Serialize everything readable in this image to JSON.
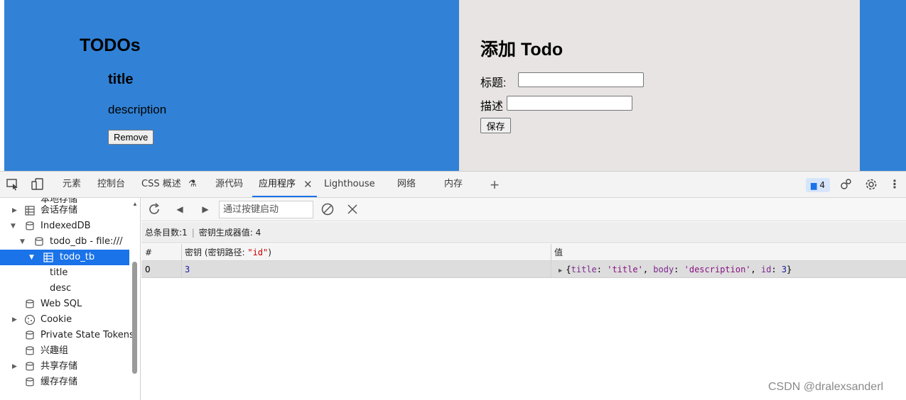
{
  "page": {
    "todos_heading": "TODOs",
    "todo_item": {
      "title": "title",
      "description": "description",
      "remove_label": "Remove"
    },
    "add_heading": "添加 Todo",
    "form": {
      "title_label": "标题:",
      "title_value": "",
      "desc_label": "描述",
      "desc_value": "",
      "save_label": "保存"
    },
    "colors": {
      "blue": "#3182d6",
      "panel_gray": "#e8e4e3"
    }
  },
  "devtools": {
    "tabs": [
      {
        "label": "元素"
      },
      {
        "label": "控制台"
      },
      {
        "label": "CSS 概述"
      },
      {
        "label": "源代码"
      },
      {
        "label": "应用程序",
        "active": true
      },
      {
        "label": "Lighthouse"
      },
      {
        "label": "网络"
      },
      {
        "label": "内存"
      }
    ],
    "issues_count": "4",
    "sidebar": {
      "cut_item": "本地存储",
      "items": [
        {
          "label": "会话存储",
          "icon": "table-icon"
        },
        {
          "label": "IndexedDB",
          "icon": "database-icon"
        },
        {
          "label": "todo_db - file:///",
          "icon": "database-icon"
        },
        {
          "label": "todo_tb",
          "icon": "table-icon",
          "selected": true
        },
        {
          "label": "title"
        },
        {
          "label": "desc"
        },
        {
          "label": "Web SQL",
          "icon": "database-icon"
        },
        {
          "label": "Cookie",
          "icon": "cookie-icon"
        },
        {
          "label": "Private State Tokens",
          "icon": "database-icon"
        },
        {
          "label": "兴趣组",
          "icon": "database-icon"
        },
        {
          "label": "共享存储",
          "icon": "database-icon"
        },
        {
          "label": "缓存存储",
          "icon": "database-icon"
        }
      ]
    },
    "toolbar": {
      "filter_placeholder": "通过按键启动"
    },
    "summary": {
      "total_label": "总条目数:",
      "total_value": "1",
      "keygen_label": "密钥生成器值:",
      "keygen_value": "4"
    },
    "table": {
      "headers": {
        "index": "#",
        "key_prefix": "密钥 (密钥路径: ",
        "key_path": "\"id\"",
        "key_suffix": ")",
        "value": "值"
      },
      "rows": [
        {
          "index": "0",
          "key": "3",
          "value": {
            "open": "{",
            "k1": "title",
            "v1": "'title'",
            "k2": "body",
            "v2": "'description'",
            "k3": "id",
            "v3": "3",
            "close": "}"
          }
        }
      ]
    }
  },
  "watermark": "CSDN @dralexsanderl"
}
